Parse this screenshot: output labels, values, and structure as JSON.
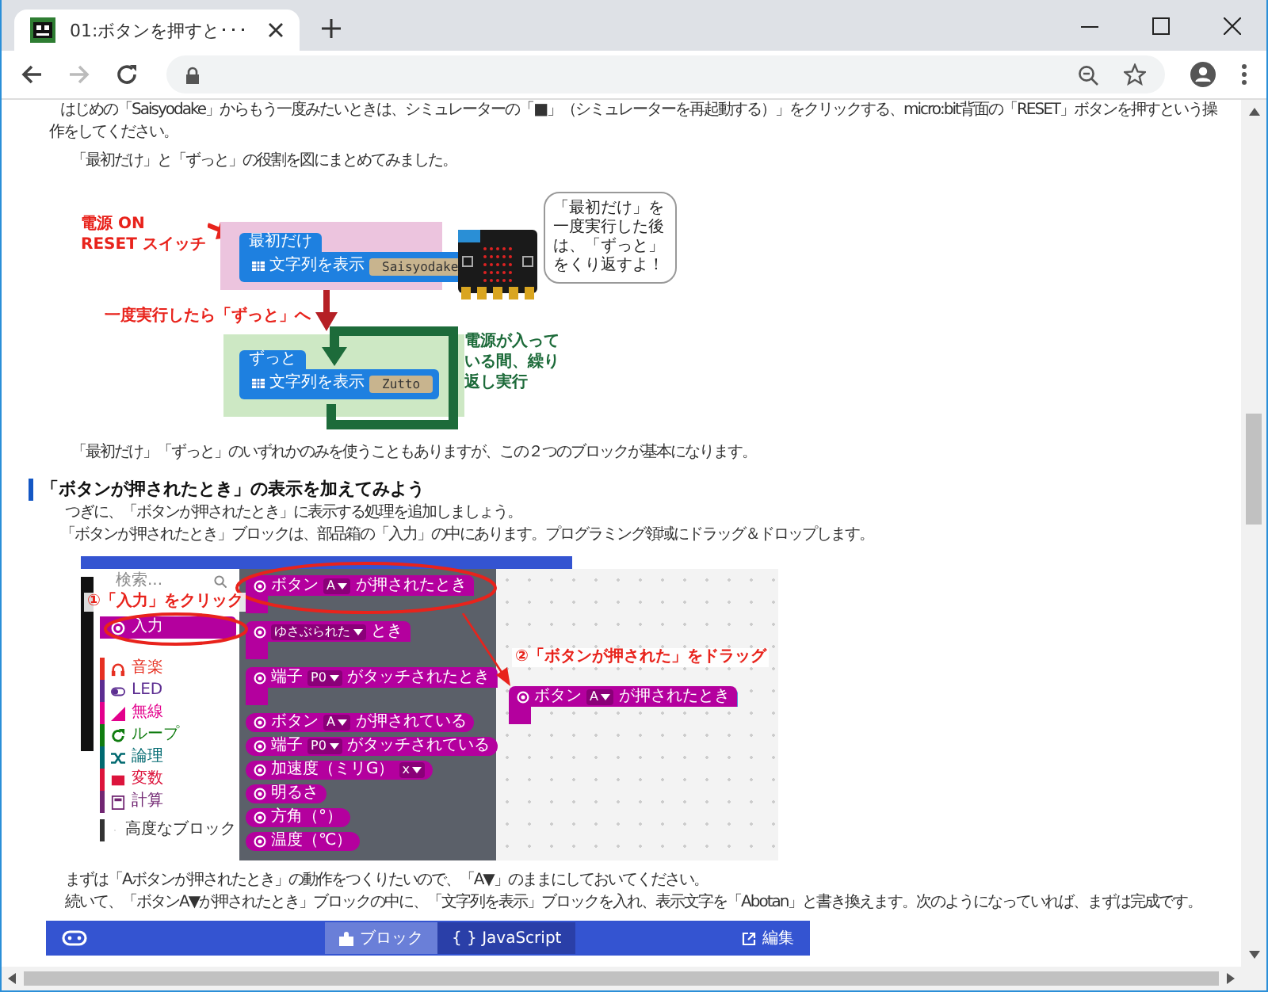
{
  "browser": {
    "tab_title": "01:ボタンを押すと･･･",
    "forward_disabled": true
  },
  "article": {
    "intro_lines": [
      "はじめの「Saisyodake」からもう一度みたいときは、シミュレーターの「■」（シミュレーターを再起動する）」をクリックする、micro:bit背面の「RESET」ボタンを押すという操",
      "作をしてください。"
    ],
    "summary": "「最初だけ」と「ずっと」の役割を図にまとめてみました。",
    "figure1": {
      "power_label": "電源 ON\nRESET スイッチ",
      "start_block": {
        "title": "最初だけ",
        "statement": "文字列を表示",
        "value": "Saisyodake"
      },
      "transition_label": "一度実行したら「ずっと」へ",
      "forever_block": {
        "title": "ずっと",
        "statement": "文字列を表示",
        "value": "Zutto"
      },
      "loop_label": "電源が入っている間、繰り返し実行",
      "speech_bubble": "「最初だけ」を一度実行した後は、「ずっと」をくり返すよ！"
    },
    "note": "「最初だけ」「ずっと」のいずれかのみを使うこともありますが、この２つのブロックが基本になります。",
    "heading": "「ボタンが押されたとき」の表示を加えてみよう",
    "section_lines": [
      "つぎに、「ボタンが押されたとき」に表示する処理を追加しましょう。",
      "「ボタンが押されたとき」ブロックは、部品箱の「入力」の中にあります。プログラミング領域にドラッグ＆ドロップします。"
    ],
    "figure2": {
      "search_placeholder": "検索...",
      "categories": [
        {
          "label": "入力",
          "color": "#b4009e",
          "selected": true
        },
        {
          "label": "音楽",
          "color": "#e63022",
          "selected": false
        },
        {
          "label": "LED",
          "color": "#5c2d91",
          "selected": false
        },
        {
          "label": "無線",
          "color": "#e3008c",
          "selected": false
        },
        {
          "label": "ループ",
          "color": "#107c10",
          "selected": false
        },
        {
          "label": "論理",
          "color": "#006970",
          "selected": false
        },
        {
          "label": "変数",
          "color": "#dc143c",
          "selected": false
        },
        {
          "label": "計算",
          "color": "#712672",
          "selected": false
        }
      ],
      "advanced": "高度なブロック",
      "flyout_blocks": [
        {
          "kind": "hat",
          "parts": [
            {
              "kind": "text",
              "text": "ボタン"
            },
            {
              "kind": "dropdown",
              "text": "A"
            },
            {
              "kind": "text",
              "text": "が押されたとき"
            }
          ]
        },
        {
          "kind": "hat",
          "parts": [
            {
              "kind": "dropdown",
              "text": "ゆさぶられた"
            },
            {
              "kind": "text",
              "text": "とき"
            }
          ]
        },
        {
          "kind": "hat",
          "parts": [
            {
              "kind": "text",
              "text": "端子"
            },
            {
              "kind": "dropdown",
              "text": "P0"
            },
            {
              "kind": "text",
              "text": "がタッチされたとき"
            }
          ]
        },
        {
          "kind": "reporter",
          "parts": [
            {
              "kind": "text",
              "text": "ボタン"
            },
            {
              "kind": "dropdown",
              "text": "A"
            },
            {
              "kind": "text",
              "text": "が押されている"
            }
          ]
        },
        {
          "kind": "reporter",
          "parts": [
            {
              "kind": "text",
              "text": "端子"
            },
            {
              "kind": "dropdown",
              "text": "P0"
            },
            {
              "kind": "text",
              "text": "がタッチされている"
            }
          ]
        },
        {
          "kind": "reporter",
          "parts": [
            {
              "kind": "text",
              "text": "加速度（ミリG）"
            },
            {
              "kind": "dropdown",
              "text": "x"
            }
          ]
        },
        {
          "kind": "reporter",
          "parts": [
            {
              "kind": "text",
              "text": "明るさ"
            }
          ]
        },
        {
          "kind": "reporter",
          "parts": [
            {
              "kind": "text",
              "text": "方角（°）"
            }
          ]
        },
        {
          "kind": "reporter",
          "parts": [
            {
              "kind": "text",
              "text": "温度（℃）"
            }
          ]
        }
      ],
      "dragged_block": {
        "kind": "hat",
        "parts": [
          {
            "kind": "text",
            "text": "ボタン"
          },
          {
            "kind": "dropdown",
            "text": "A"
          },
          {
            "kind": "text",
            "text": "が押されたとき"
          }
        ]
      },
      "step1_label": "①「入力」をクリック",
      "step2_label": "②「ボタンが押された」をドラッグ"
    },
    "after_lines": [
      "まずは「Aボタンが押されたとき」の動作をつくりたいので、「A▼」のままにしておいてください。",
      "続いて、「ボタンA▼が押されたとき」ブロックの中に、「文字列を表示」ブロックを入れ、表示文字を「Abotan」と書き換えます。次のようになっていれば、まずは完成です。"
    ],
    "editor": {
      "tabs": [
        {
          "label": "ブロック",
          "selected": true
        },
        {
          "label": "{ } JavaScript",
          "selected": false
        }
      ],
      "edit_link": "編集"
    }
  }
}
